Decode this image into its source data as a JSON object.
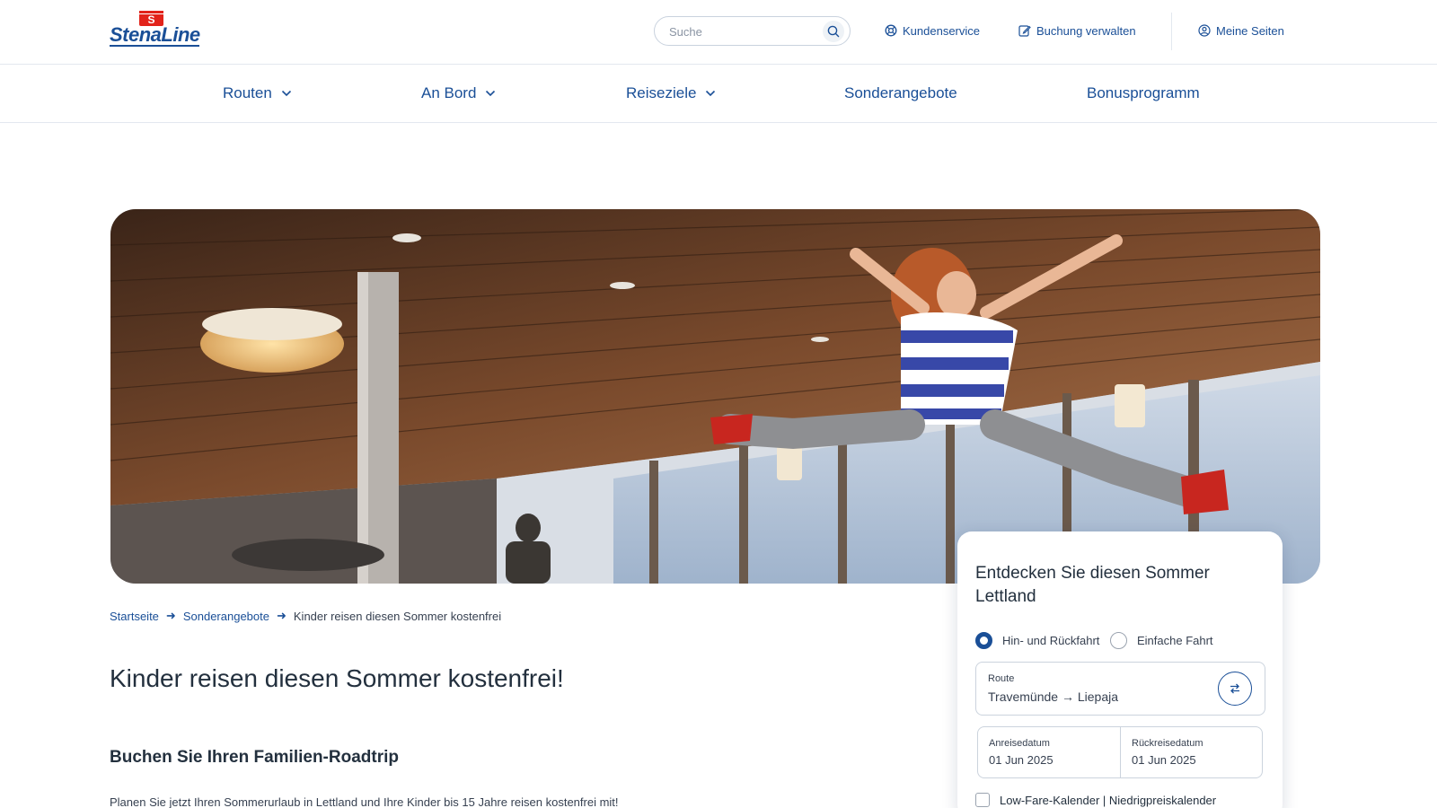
{
  "brand": {
    "name": "StenaLine",
    "flag_letter": "S",
    "color": "#1a4f97",
    "flag_color": "#e2231a"
  },
  "header": {
    "search_placeholder": "Suche",
    "customer_service": "Kundenservice",
    "manage_booking": "Buchung verwalten",
    "my_pages": "Meine Seiten"
  },
  "nav": {
    "items": [
      {
        "label": "Routen",
        "has_dropdown": true
      },
      {
        "label": "An Bord",
        "has_dropdown": true
      },
      {
        "label": "Reiseziele",
        "has_dropdown": true
      },
      {
        "label": "Sonderangebote",
        "has_dropdown": false
      },
      {
        "label": "Bonusprogramm",
        "has_dropdown": false
      }
    ]
  },
  "breadcrumb": {
    "items": [
      {
        "label": "Startseite"
      },
      {
        "label": "Sonderangebote"
      },
      {
        "label": "Kinder reisen diesen Sommer kostenfrei"
      }
    ]
  },
  "content": {
    "title": "Kinder reisen diesen Sommer kostenfrei!",
    "section_title": "Buchen Sie Ihren Familien-Roadtrip",
    "intro": "Planen Sie jetzt Ihren Sommerurlaub in Lettland und Ihre Kinder bis 15 Jahre reisen kostenfrei mit!"
  },
  "booking": {
    "title": "Entdecken Sie diesen Sommer Lettland",
    "trip_types": [
      {
        "label": "Hin- und Rückfahrt",
        "selected": true
      },
      {
        "label": "Einfache Fahrt",
        "selected": false
      }
    ],
    "route_label": "Route",
    "route_value": "Travemünde → Liepaja",
    "departure_label": "Anreisedatum",
    "departure_value": "01 Jun 2025",
    "return_label": "Rückreisedatum",
    "return_value": "01 Jun 2025",
    "low_fare_label": "Low-Fare-Kalender | Niedrigpreiskalender",
    "low_fare_checked": false
  }
}
